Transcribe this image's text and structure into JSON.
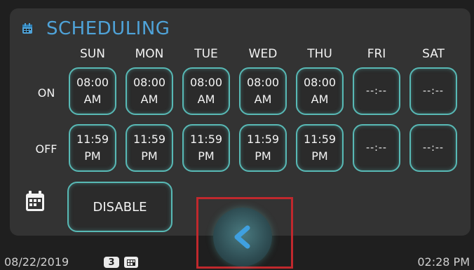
{
  "header": {
    "title": "SCHEDULING",
    "icon": "schedule-icon"
  },
  "days": [
    "SUN",
    "MON",
    "TUE",
    "WED",
    "THU",
    "FRI",
    "SAT"
  ],
  "row_labels": {
    "on": "ON",
    "off": "OFF"
  },
  "on_times": [
    [
      "08:00",
      "AM"
    ],
    [
      "08:00",
      "AM"
    ],
    [
      "08:00",
      "AM"
    ],
    [
      "08:00",
      "AM"
    ],
    [
      "08:00",
      "AM"
    ],
    [
      "--:--"
    ],
    [
      "--:--"
    ]
  ],
  "off_times": [
    [
      "11:59",
      "PM"
    ],
    [
      "11:59",
      "PM"
    ],
    [
      "11:59",
      "PM"
    ],
    [
      "11:59",
      "PM"
    ],
    [
      "11:59",
      "PM"
    ],
    [
      "--:--"
    ],
    [
      "--:--"
    ]
  ],
  "actions": {
    "disable_label": "DISABLE",
    "back_icon": "chevron-left-icon"
  },
  "status_bar": {
    "date": "08/22/2019",
    "badge": "3",
    "time": "02:28 PM"
  },
  "colors": {
    "accent": "#4fa3d9",
    "border": "#58b9b5",
    "highlight": "#c0282d"
  }
}
